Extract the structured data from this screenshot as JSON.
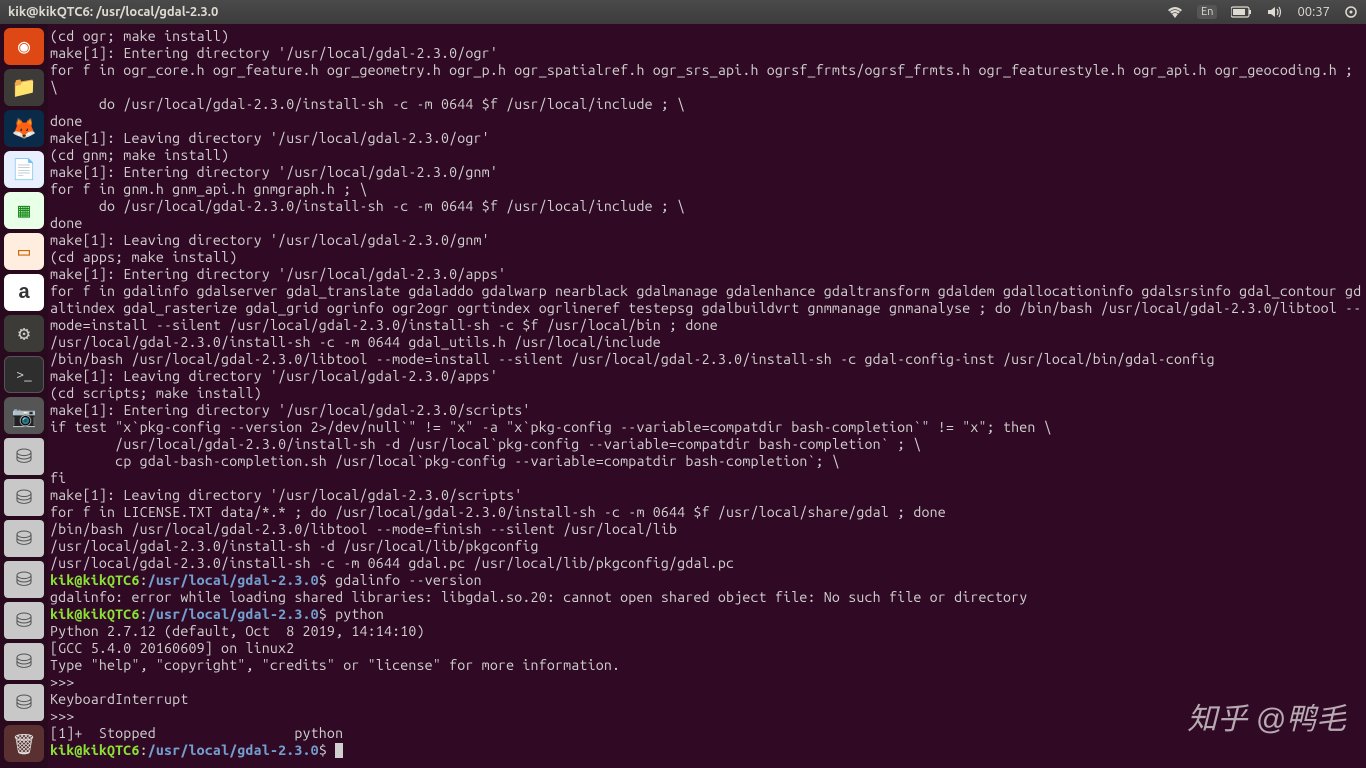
{
  "topbar": {
    "title": "kik@kikQTC6: /usr/local/gdal-2.3.0",
    "lang": "En",
    "time": "00:37"
  },
  "launcher": [
    {
      "name": "ubuntu-dash",
      "cls": "ubuntu-logo",
      "glyph": "◉"
    },
    {
      "name": "nautilus",
      "cls": "nautilus",
      "glyph": "📁"
    },
    {
      "name": "firefox",
      "cls": "firefox",
      "glyph": "🦊"
    },
    {
      "name": "writer",
      "cls": "writer",
      "glyph": "📄"
    },
    {
      "name": "calc",
      "cls": "calc",
      "glyph": "▦"
    },
    {
      "name": "impress",
      "cls": "impress",
      "glyph": "▭"
    },
    {
      "name": "amazon",
      "cls": "amazon",
      "glyph": "a"
    },
    {
      "name": "settings",
      "cls": "settings",
      "glyph": "⚙"
    },
    {
      "name": "terminal",
      "cls": "terminal-icon",
      "glyph": ">_"
    },
    {
      "name": "screenshot",
      "cls": "screenshot",
      "glyph": "📷"
    },
    {
      "name": "drive1",
      "cls": "drive",
      "glyph": "⛁"
    },
    {
      "name": "drive2",
      "cls": "drive",
      "glyph": "⛁"
    },
    {
      "name": "drive3",
      "cls": "drive",
      "glyph": "⛁"
    },
    {
      "name": "drive4",
      "cls": "drive",
      "glyph": "⛁"
    },
    {
      "name": "drive5",
      "cls": "drive",
      "glyph": "⛁"
    },
    {
      "name": "drive6",
      "cls": "drive",
      "glyph": "⛁"
    },
    {
      "name": "drive7",
      "cls": "drive",
      "glyph": "⛁"
    }
  ],
  "trash_glyph": "🗑",
  "prompt": {
    "user_host": "kik@kikQTC6",
    "sep": ":",
    "path": "/usr/local/gdal-2.3.0",
    "dollar": "$"
  },
  "commands": {
    "gdalinfo": " gdalinfo --version",
    "python": " python",
    "empty": " "
  },
  "lines": [
    "(cd ogr; make install)",
    "make[1]: Entering directory '/usr/local/gdal-2.3.0/ogr'",
    "for f in ogr_core.h ogr_feature.h ogr_geometry.h ogr_p.h ogr_spatialref.h ogr_srs_api.h ogrsf_frmts/ogrsf_frmts.h ogr_featurestyle.h ogr_api.h ogr_geocoding.h ; \\",
    "      do /usr/local/gdal-2.3.0/install-sh -c -m 0644 $f /usr/local/include ; \\",
    "done",
    "make[1]: Leaving directory '/usr/local/gdal-2.3.0/ogr'",
    "(cd gnm; make install)",
    "make[1]: Entering directory '/usr/local/gdal-2.3.0/gnm'",
    "for f in gnm.h gnm_api.h gnmgraph.h ; \\",
    "      do /usr/local/gdal-2.3.0/install-sh -c -m 0644 $f /usr/local/include ; \\",
    "done",
    "make[1]: Leaving directory '/usr/local/gdal-2.3.0/gnm'",
    "(cd apps; make install)",
    "make[1]: Entering directory '/usr/local/gdal-2.3.0/apps'",
    "for f in gdalinfo gdalserver gdal_translate gdaladdo gdalwarp nearblack gdalmanage gdalenhance gdaltransform gdaldem gdallocationinfo gdalsrsinfo gdal_contour gdaltindex gdal_rasterize gdal_grid ogrinfo ogr2ogr ogrtindex ogrlineref testepsg gdalbuildvrt gnmmanage gnmanalyse ; do /bin/bash /usr/local/gdal-2.3.0/libtool --mode=install --silent /usr/local/gdal-2.3.0/install-sh -c $f /usr/local/bin ; done",
    "/usr/local/gdal-2.3.0/install-sh -c -m 0644 gdal_utils.h /usr/local/include",
    "/bin/bash /usr/local/gdal-2.3.0/libtool --mode=install --silent /usr/local/gdal-2.3.0/install-sh -c gdal-config-inst /usr/local/bin/gdal-config",
    "make[1]: Leaving directory '/usr/local/gdal-2.3.0/apps'",
    "(cd scripts; make install)",
    "make[1]: Entering directory '/usr/local/gdal-2.3.0/scripts'",
    "if test \"x`pkg-config --version 2>/dev/null`\" != \"x\" -a \"x`pkg-config --variable=compatdir bash-completion`\" != \"x\"; then \\",
    "        /usr/local/gdal-2.3.0/install-sh -d /usr/local`pkg-config --variable=compatdir bash-completion` ; \\",
    "        cp gdal-bash-completion.sh /usr/local`pkg-config --variable=compatdir bash-completion`; \\",
    "fi",
    "make[1]: Leaving directory '/usr/local/gdal-2.3.0/scripts'",
    "for f in LICENSE.TXT data/*.* ; do /usr/local/gdal-2.3.0/install-sh -c -m 0644 $f /usr/local/share/gdal ; done",
    "/bin/bash /usr/local/gdal-2.3.0/libtool --mode=finish --silent /usr/local/lib",
    "/usr/local/gdal-2.3.0/install-sh -d /usr/local/lib/pkgconfig",
    "/usr/local/gdal-2.3.0/install-sh -c -m 0644 gdal.pc /usr/local/lib/pkgconfig/gdal.pc"
  ],
  "gdalinfo_error": "gdalinfo: error while loading shared libraries: libgdal.so.20: cannot open shared object file: No such file or directory",
  "python_out": [
    "Python 2.7.12 (default, Oct  8 2019, 14:14:10) ",
    "[GCC 5.4.0 20160609] on linux2",
    "Type \"help\", \"copyright\", \"credits\" or \"license\" for more information.",
    ">>> ",
    "KeyboardInterrupt",
    ">>> ",
    "[1]+  Stopped                 python"
  ],
  "watermark": "知乎 @鸭毛"
}
